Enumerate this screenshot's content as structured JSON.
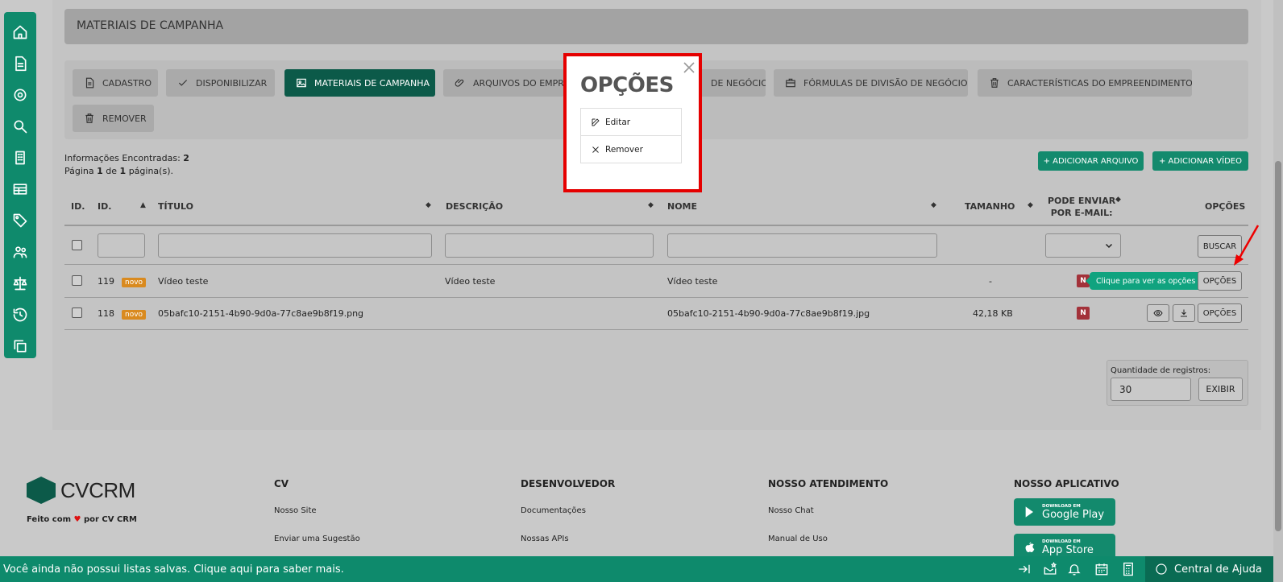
{
  "section_title": "MATERIAIS DE CAMPANHA",
  "tabs": [
    {
      "label": "CADASTRO",
      "icon": "file-icon"
    },
    {
      "label": "DISPONIBILIZAR",
      "icon": "check-icon"
    },
    {
      "label": "MATERIAIS DE CAMPANHA",
      "icon": "image-icon",
      "active": true
    },
    {
      "label": "ARQUIVOS DO EMPREENDIMENTO",
      "icon": "paperclip-icon"
    },
    {
      "label": "DE NEGÓCIO",
      "icon": "briefcase-icon"
    },
    {
      "label": "FÓRMULAS DE DIVISÃO DE NEGÓCIO",
      "icon": "briefcase-icon"
    },
    {
      "label": "CARACTERÍSTICAS DO EMPREENDIMENTO",
      "icon": "trash-icon"
    },
    {
      "label": "REMOVER",
      "icon": "trash-icon"
    }
  ],
  "info": {
    "found_label": "Informações Encontradas:",
    "found_count": "2",
    "page_prefix": "Página",
    "page_current": "1",
    "page_of": "de",
    "page_total": "1",
    "page_suffix": "página(s)."
  },
  "actions": {
    "add_file": "+ ADICIONAR ARQUIVO",
    "add_video": "+ ADICIONAR VÍDEO"
  },
  "table": {
    "headers": {
      "id1": "ID.",
      "id2": "ID.",
      "titulo": "TÍTULO",
      "descricao": "DESCRIÇÃO",
      "nome": "NOME",
      "tamanho": "TAMANHO",
      "pode_enviar_1": "PODE ENVIAR",
      "pode_enviar_2": "POR E-MAIL:",
      "opcoes": "OPÇÕES"
    },
    "search_button": "BUSCAR",
    "rows": [
      {
        "id": "119",
        "badge": "novo",
        "titulo": "Vídeo teste",
        "descricao": "Vídeo teste",
        "nome": "Vídeo teste",
        "tamanho": "-",
        "email": "N",
        "opcoes": "OPÇÕES"
      },
      {
        "id": "118",
        "badge": "novo",
        "titulo": "05bafc10-2151-4b90-9d0a-77c8ae9b8f19.png",
        "descricao": "",
        "nome": "05bafc10-2151-4b90-9d0a-77c8ae9b8f19.jpg",
        "tamanho": "42,18 KB",
        "email": "N",
        "opcoes": "OPÇÕES"
      }
    ],
    "tooltip": "Clique para ver as opções"
  },
  "quantity": {
    "label": "Quantidade de registros:",
    "value": "30",
    "button": "EXIBIR"
  },
  "modal": {
    "title": "OPÇÕES",
    "items": [
      "Editar",
      "Remover"
    ]
  },
  "footer": {
    "brand": "CVCRM",
    "made_by_prefix": "Feito com",
    "made_by_suffix": "por CV CRM",
    "columns": [
      {
        "title": "CV",
        "links": [
          "Nosso Site",
          "Enviar uma Sugestão"
        ]
      },
      {
        "title": "DESENVOLVEDOR",
        "links": [
          "Documentações",
          "Nossas APIs"
        ]
      },
      {
        "title": "NOSSO ATENDIMENTO",
        "links": [
          "Nosso Chat",
          "Manual de Uso"
        ]
      },
      {
        "title": "NOSSO APLICATIVO",
        "links": []
      }
    ],
    "stores": [
      {
        "small": "DOWNLOAD EM",
        "big": "Google Play"
      },
      {
        "small": "DOWNLOAD EM",
        "big": "App Store"
      }
    ]
  },
  "bottom_bar": {
    "message": "Você ainda não possui listas salvas. Clique aqui para saber mais.",
    "help": "Central de Ajuda"
  },
  "colors": {
    "brand_green": "#0f8a6c",
    "active_tab": "#0c5a49",
    "highlight_red": "#e50000",
    "badge_orange": "#d98a1f",
    "badge_red": "#a3323a"
  }
}
